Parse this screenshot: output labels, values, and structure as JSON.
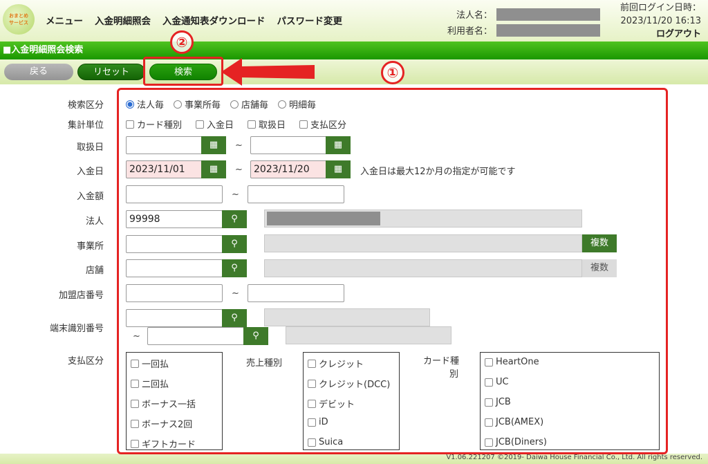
{
  "header": {
    "logo_line1": "おまとめ",
    "logo_line2": "サービス",
    "nav": [
      "メニュー",
      "入金明細照会",
      "入金通知表ダウンロード",
      "パスワード変更"
    ],
    "corp_label": "法人名：",
    "user_label": "利用者名：",
    "last_login_label": "前回ログイン日時：",
    "last_login_value": "2023/11/20 16:13",
    "logout": "ログアウト"
  },
  "titlebar": "■入金明細照会検索",
  "buttons": {
    "back": "戻る",
    "reset": "リセット",
    "search": "検索"
  },
  "annotations": {
    "one": "①",
    "two": "②"
  },
  "form": {
    "search_type": {
      "label": "検索区分",
      "options": [
        "法人毎",
        "事業所毎",
        "店舗毎",
        "明細毎"
      ],
      "selected": "法人毎"
    },
    "aggregate": {
      "label": "集計単位",
      "options": [
        "カード種別",
        "入金日",
        "取扱日",
        "支払区分"
      ]
    },
    "handling_date": {
      "label": "取扱日",
      "from": "",
      "to": ""
    },
    "deposit_date": {
      "label": "入金日",
      "from": "2023/11/01",
      "to": "2023/11/20",
      "note": "入金日は最大12か月の指定が可能です"
    },
    "amount": {
      "label": "入金額",
      "from": "",
      "to": ""
    },
    "corporation": {
      "label": "法人",
      "value": "99998"
    },
    "office": {
      "label": "事業所",
      "value": "",
      "multi": "複数"
    },
    "store": {
      "label": "店舗",
      "value": "",
      "multi": "複数"
    },
    "merchant_no": {
      "label": "加盟店番号",
      "from": "",
      "to": ""
    },
    "terminal_id": {
      "label": "端末識別番号"
    },
    "tilde": "~",
    "payment_type": {
      "label": "支払区分",
      "items": [
        "一回払",
        "二回払",
        "ボーナス一括",
        "ボーナス2回",
        "ギフトカード"
      ]
    },
    "sales_type": {
      "label": "売上種別",
      "items": [
        "クレジット",
        "クレジット(DCC)",
        "デビット",
        "iD",
        "Suica"
      ]
    },
    "card_type": {
      "label_line1": "カード種",
      "label_line2": "別",
      "items": [
        "HeartOne",
        "UC",
        "JCB",
        "JCB(AMEX)",
        "JCB(Diners)"
      ]
    }
  },
  "footer": {
    "copyright": "V1.06.221207  ©2019- Daiwa House Financial Co., Ltd. All rights reserved."
  },
  "colors": {
    "accent": "#1a9700",
    "annotation": "#e52323",
    "button_green": "#3e7a2a"
  }
}
